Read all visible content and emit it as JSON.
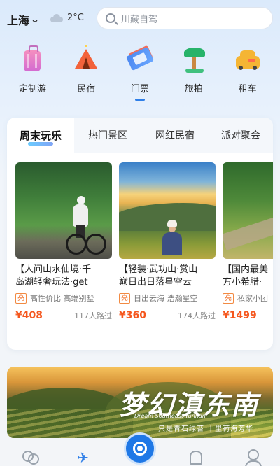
{
  "header": {
    "city": "上海",
    "temperature": "2°C",
    "search_placeholder": "川藏自驾"
  },
  "categories": [
    {
      "label": "定制游",
      "icon": "suitcase-icon"
    },
    {
      "label": "民宿",
      "icon": "tent-icon"
    },
    {
      "label": "门票",
      "icon": "ticket-icon",
      "active": true
    },
    {
      "label": "旅拍",
      "icon": "palm-tree-icon"
    },
    {
      "label": "租车",
      "icon": "taxi-icon"
    }
  ],
  "tabs": [
    {
      "label": "周末玩乐",
      "active": true
    },
    {
      "label": "热门景区"
    },
    {
      "label": "网红民宿"
    },
    {
      "label": "派对聚会"
    }
  ],
  "cards": [
    {
      "title_line1": "【人间山水仙境·千",
      "title_line2": "岛湖轻奢玩法·get",
      "tag": "亮",
      "tag_text": "高性价比 高端别墅",
      "price": "¥408",
      "visits": "117人路过"
    },
    {
      "title_line1": "【轻装·武功山·赏山",
      "title_line2": "巅日出日落星空云",
      "tag": "亮",
      "tag_text": "日出云海 浩瀚星空",
      "price": "¥360",
      "visits": "174人路过"
    },
    {
      "title_line1": "【国内最美",
      "title_line2": "方小希腊·",
      "tag": "亮",
      "tag_text": "私家小团",
      "price": "¥1499",
      "visits": ""
    }
  ],
  "banner": {
    "headline": "梦幻滇东南",
    "english": "Dream Southeast Yunnan",
    "subtitle": "只是青石绿苔 十里荷海芳华"
  },
  "nav": [
    {
      "icon": "people-icon"
    },
    {
      "icon": "airplane-icon",
      "active": true
    },
    {
      "icon": "camera-center-icon"
    },
    {
      "icon": "bell-icon"
    },
    {
      "icon": "person-icon"
    }
  ],
  "colors": {
    "accent": "#2f7fe8",
    "price": "#f5571e",
    "tag": "#f06b20"
  }
}
